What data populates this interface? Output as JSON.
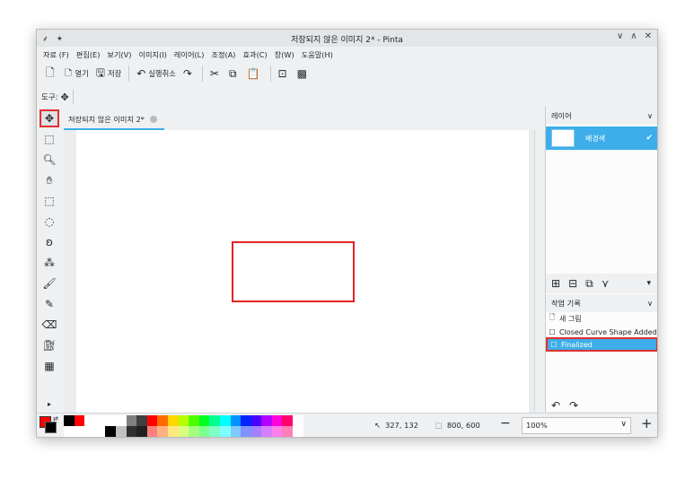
{
  "window": {
    "title": "저장되지 않은 이미지 2* - Pinta",
    "title_left_icons": "⸙ ✦",
    "controls": [
      "∨",
      "∧",
      "✕"
    ]
  },
  "menu": [
    "자료 (F)",
    "편집(E)",
    "보기(V)",
    "이미지(I)",
    "레이어(L)",
    "조정(A)",
    "효과(C)",
    "창(W)",
    "도움말(H)"
  ],
  "toolbar": {
    "new_icon": "🗋",
    "new_image_icon": "🗅",
    "open_label": "열기",
    "save_label": "저장",
    "undo_label": "실행취소",
    "redo_icon": "↷",
    "cut_icon": "✂",
    "copy_icon": "⧉",
    "paste_icon": "📋",
    "crop_icon": "⊡",
    "deselect_icon": "▩"
  },
  "tool_row": {
    "label": "도구:",
    "icon": "✥"
  },
  "tools": [
    {
      "name": "move-selected-tool-icon",
      "glyph": "✥"
    },
    {
      "name": "move-selection-tool-icon",
      "glyph": "⬚"
    },
    {
      "name": "zoom-tool-icon",
      "glyph": "🔍︎"
    },
    {
      "name": "pan-tool-icon",
      "glyph": "✋︎"
    },
    {
      "name": "rectangle-select-tool-icon",
      "glyph": "⬚"
    },
    {
      "name": "ellipse-select-tool-icon",
      "glyph": "◌"
    },
    {
      "name": "lasso-select-tool-icon",
      "glyph": "ʚ"
    },
    {
      "name": "magic-wand-tool-icon",
      "glyph": "⁂"
    },
    {
      "name": "paintbrush-tool-icon",
      "glyph": "🖌︎"
    },
    {
      "name": "pencil-tool-icon",
      "glyph": "✎"
    },
    {
      "name": "eraser-tool-icon",
      "glyph": "⌫"
    },
    {
      "name": "paint-bucket-tool-icon",
      "glyph": "⛽︎"
    },
    {
      "name": "gradient-tool-icon",
      "glyph": "▦"
    },
    {
      "name": "more-tools-icon",
      "glyph": "▸"
    }
  ],
  "document": {
    "tab_title": "저장되지 않은 이미지 2*"
  },
  "layers_panel": {
    "header": "레이어",
    "layer_name": "배경색",
    "check": "✔"
  },
  "layer_tools": [
    "⊞",
    "⊟",
    "⧉",
    "⋎",
    "▾"
  ],
  "history_panel": {
    "header": "작업 기록",
    "items": [
      {
        "icon": "🗋",
        "label": "새 그림"
      },
      {
        "icon": "☐",
        "label": "Closed Curve Shape Added"
      },
      {
        "icon": "☐",
        "label": "Finalized"
      }
    ],
    "undo_icon": "↶",
    "redo_icon": "↷"
  },
  "status": {
    "cursor_icon": "↖",
    "cursor_pos": "327, 132",
    "size_icon": "⬚",
    "image_size": "800, 600",
    "zoom_out": "−",
    "zoom": "100%",
    "zoom_chevron": "∨",
    "zoom_in": "+"
  },
  "colors": {
    "primary": "#ff0000",
    "secondary": "#000000",
    "accent": "#3daee9",
    "shape_stroke": "#e52222"
  },
  "palette": [
    [
      "#000000",
      "#ff0000",
      "#ffffff",
      "#ffffff",
      "#ffffff",
      "#ffffff",
      "#808080",
      "#404040",
      "#ff0000",
      "#ff6a00",
      "#ffd800",
      "#b6ff00",
      "#4cff00",
      "#00ff21",
      "#00ff90",
      "#00ffff",
      "#0094ff",
      "#0026ff",
      "#4800ff",
      "#b200ff",
      "#ff00dc",
      "#ff006e",
      "#ffffff"
    ],
    [
      "#ffffff",
      "#ffffff",
      "#ffffff",
      "#ffffff",
      "#000000",
      "#c0c0c0",
      "#303030",
      "#202020",
      "#ff7f7f",
      "#ffb27f",
      "#ffe97f",
      "#daff7f",
      "#a5ff7f",
      "#7fff8e",
      "#7fffc5",
      "#7fffff",
      "#7fc9ff",
      "#7f92ff",
      "#a17fff",
      "#d67fff",
      "#ff7fed",
      "#ff7fb6",
      "#ffffff"
    ]
  ]
}
